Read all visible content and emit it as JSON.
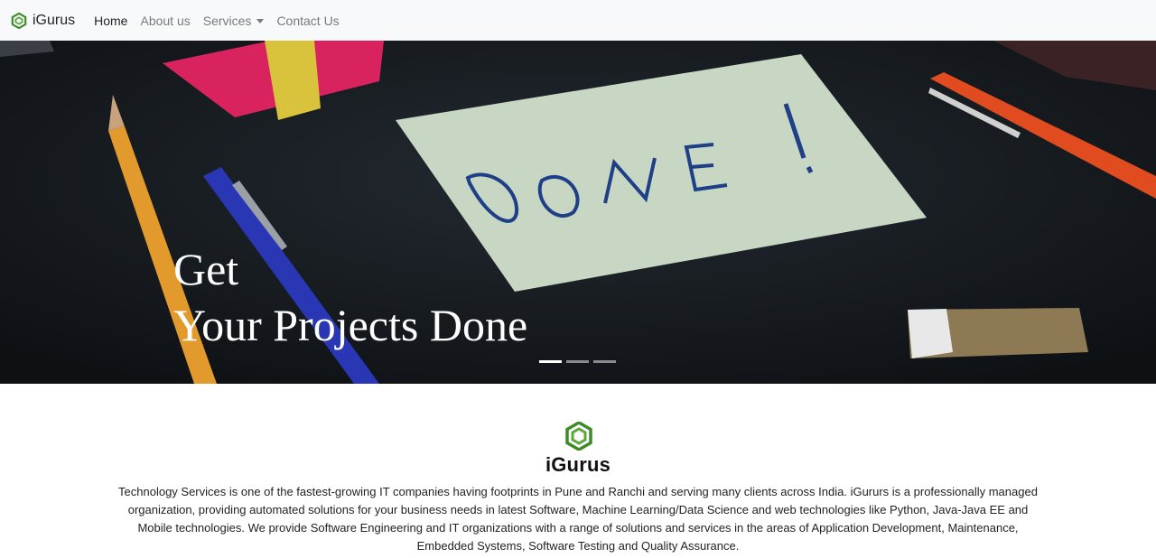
{
  "navbar": {
    "brand": "iGurus",
    "items": [
      {
        "label": "Home",
        "active": true
      },
      {
        "label": "About us"
      },
      {
        "label": "Services",
        "dropdown": true
      },
      {
        "label": "Contact Us"
      }
    ]
  },
  "hero": {
    "line1": "Get",
    "line2": "Your Projects Done",
    "note_text": "DONE!",
    "slides": 3,
    "active_slide": 1
  },
  "about": {
    "name": "iGurus",
    "description": "Technology Services is one of the fastest-growing IT companies having footprints in Pune and Ranchi and serving many clients across India. iGururs is a professionally managed organization, providing automated solutions for your business needs in latest Software, Machine Learning/Data Science and web technologies like Python, Java-Java EE and Mobile technologies. We provide Software Engineering and IT organizations with a range of solutions and services in the areas of Application Development, Maintenance, Embedded Systems, Software Testing and Quality Assurance."
  },
  "colors": {
    "navbar_bg": "#f8f9fa",
    "brand_green": "#3f8b2a",
    "nav_active": "#212529",
    "nav_inactive": "#7a7a7a"
  },
  "icons": [
    "hexagon-logo-icon",
    "caret-down-icon"
  ]
}
